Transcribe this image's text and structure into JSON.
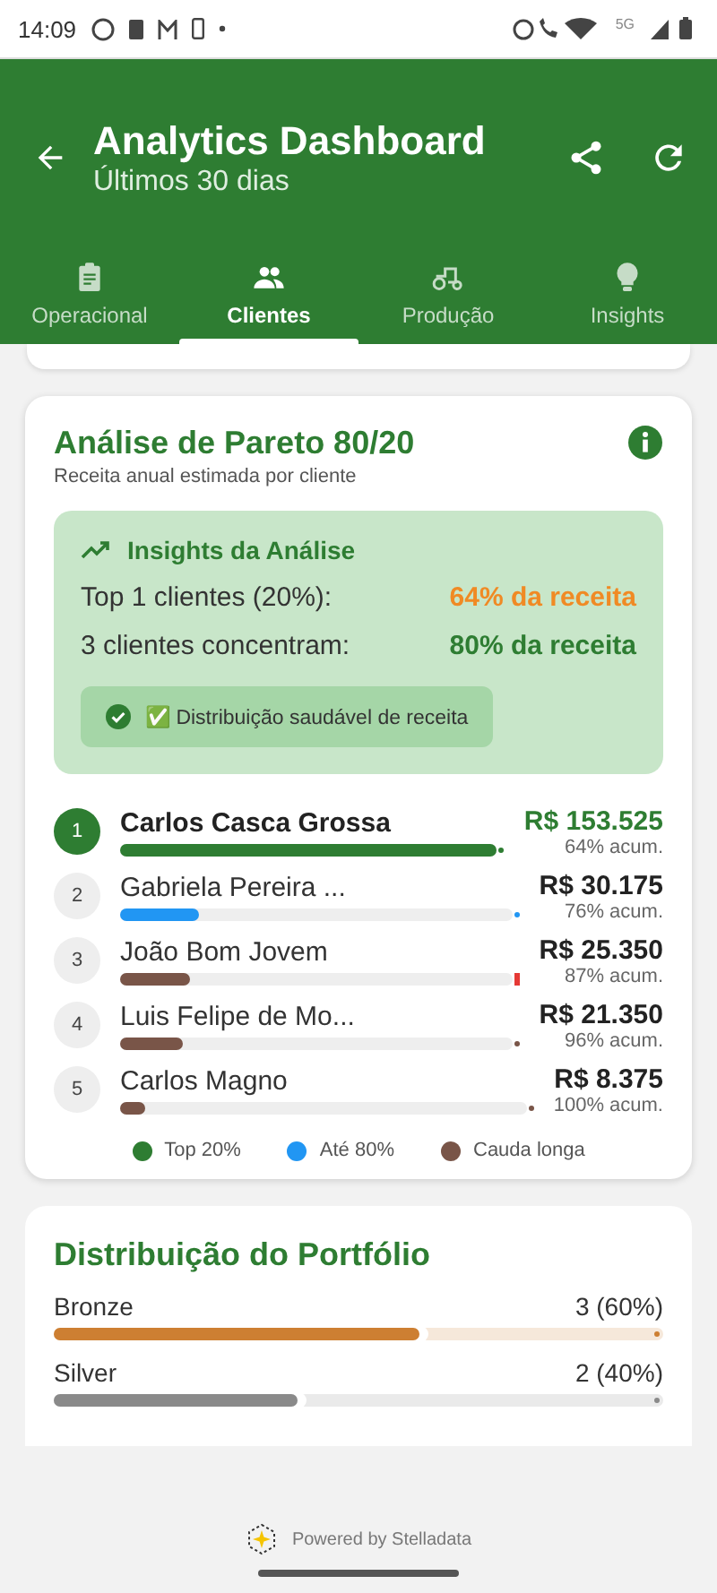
{
  "status_bar": {
    "time": "14:09",
    "network": "5G"
  },
  "app_bar": {
    "title": "Analytics Dashboard",
    "subtitle": "Últimos 30 dias"
  },
  "tabs": [
    {
      "label": "Operacional",
      "kind": "clipboard",
      "selected": false
    },
    {
      "label": "Clientes",
      "kind": "people",
      "selected": true
    },
    {
      "label": "Produção",
      "kind": "tractor",
      "selected": false
    },
    {
      "label": "Insights",
      "kind": "bulb",
      "selected": false
    }
  ],
  "pareto": {
    "title": "Análise de Pareto 80/20",
    "subtitle": "Receita anual estimada por cliente",
    "insights": {
      "title": "Insights da Análise",
      "lines": [
        {
          "label": "Top 1 clientes (20%):",
          "value": "64% da receita",
          "color": "#f08a24"
        },
        {
          "label": "3 clientes concentram:",
          "value": "80% da receita",
          "color": "#2e7d32"
        }
      ],
      "badge": "✅ Distribuição saudável de receita"
    },
    "rows": [
      {
        "rank": "1",
        "name": "Carlos Casca Grossa",
        "amount": "R$ 153.525",
        "acum": "64% acum.",
        "level": 1,
        "color": "#2e7d32",
        "threshold": false,
        "selected": true
      },
      {
        "rank": "2",
        "name": "Gabriela Pereira ...",
        "amount": "R$ 30.175",
        "acum": "76% acum.",
        "level": 0.2,
        "color": "#2196f3",
        "threshold": false,
        "selected": false
      },
      {
        "rank": "3",
        "name": "João Bom Jovem",
        "amount": "R$ 25.350",
        "acum": "87% acum.",
        "level": 0.18,
        "color": "#795548",
        "threshold": true,
        "selected": false
      },
      {
        "rank": "4",
        "name": "Luis Felipe de Mo...",
        "amount": "R$ 21.350",
        "acum": "96% acum.",
        "level": 0.16,
        "color": "#795548",
        "threshold": false,
        "selected": false
      },
      {
        "rank": "5",
        "name": "Carlos Magno",
        "amount": "R$ 8.375",
        "acum": "100% acum.",
        "level": 0.06,
        "color": "#795548",
        "threshold": false,
        "selected": false
      }
    ],
    "legend": [
      {
        "label": "Top 20%",
        "color": "#2e7d32"
      },
      {
        "label": "Até 80%",
        "color": "#2196f3"
      },
      {
        "label": "Cauda longa",
        "color": "#795548"
      }
    ]
  },
  "portfolio": {
    "title": "Distribuição do Portfólio",
    "items": [
      {
        "label": "Bronze",
        "value": "3 (60%)",
        "level": 0.6,
        "color": "#cd7f32"
      },
      {
        "label": "Silver",
        "value": "2 (40%)",
        "level": 0.4,
        "color": "#8a8a8a"
      }
    ]
  },
  "footer": {
    "text": "Powered by Stelladata"
  }
}
